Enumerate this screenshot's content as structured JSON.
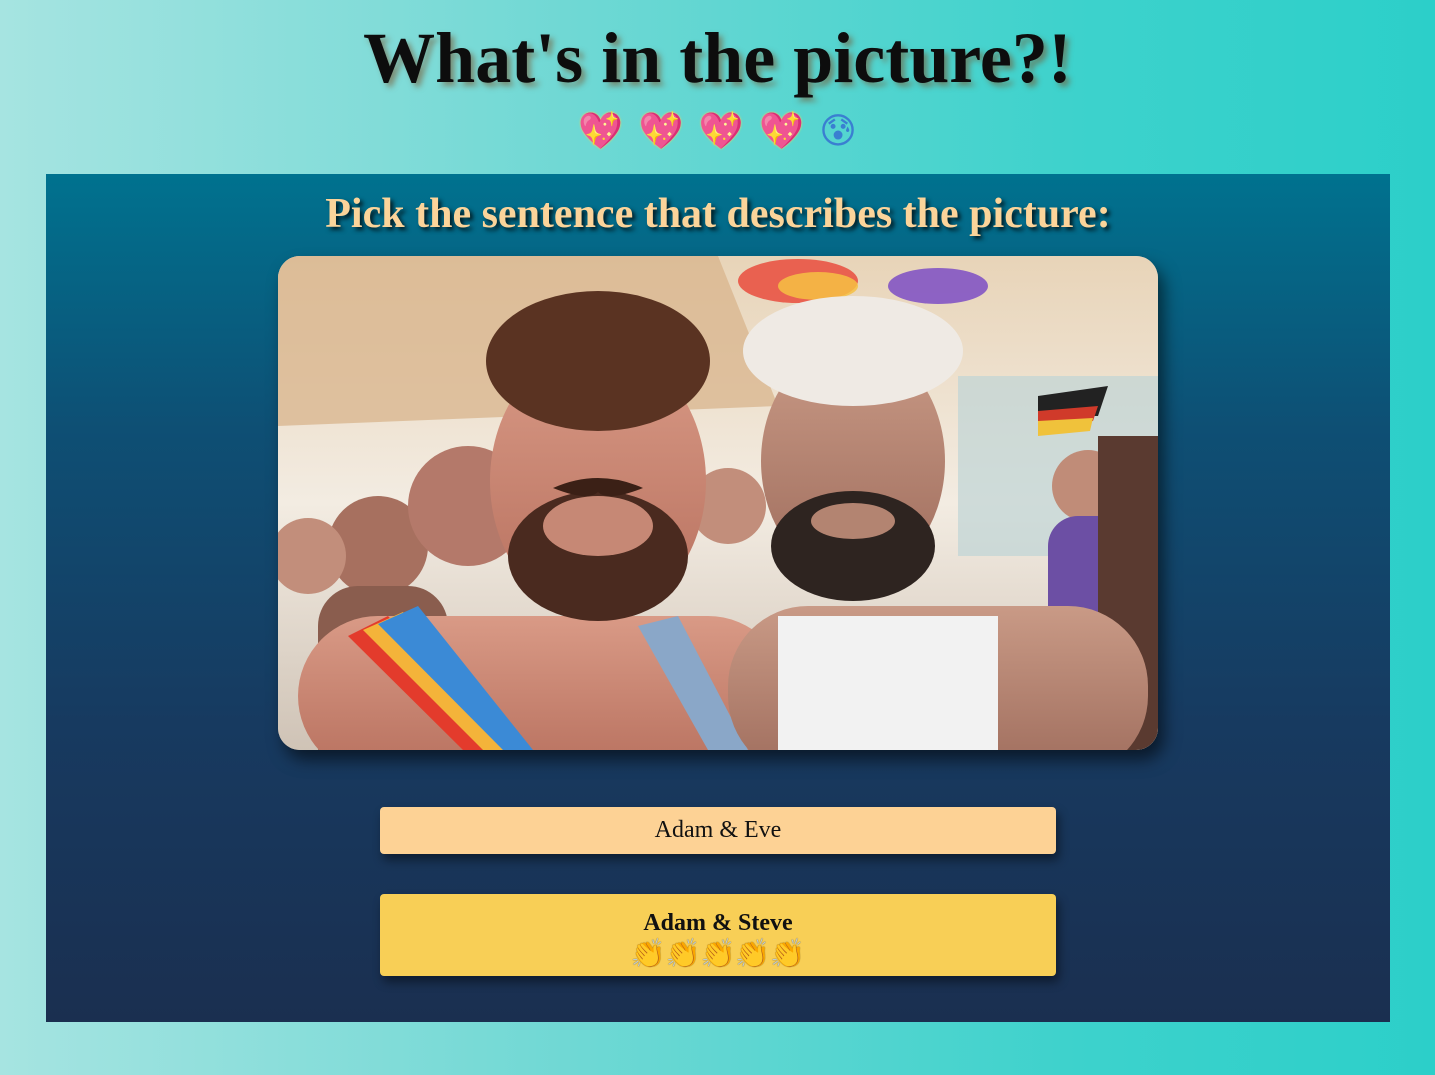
{
  "header": {
    "title": "What's in the picture?!",
    "lives": [
      "💖",
      "💖",
      "💖",
      "💖",
      "😰"
    ]
  },
  "panel": {
    "prompt": "Pick the sentence that describes the picture:",
    "photo_alt": "Two smiling bearded men at a pride celebration"
  },
  "answers": [
    {
      "label": "Adam & Eve",
      "feedback": ""
    },
    {
      "label": "Adam & Steve",
      "feedback": "👏👏👏👏👏"
    }
  ],
  "colors": {
    "page_gradient_start": "#a6e4e1",
    "page_gradient_end": "#2ccfc9",
    "panel_top": "#00728f",
    "panel_bottom": "#1a2f50",
    "prompt_text": "#fbd49a",
    "answer_default": "#fdd295",
    "answer_correct": "#f8cf56"
  }
}
